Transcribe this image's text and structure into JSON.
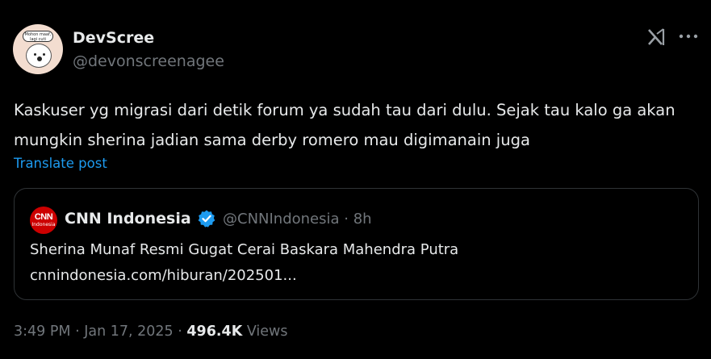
{
  "author": {
    "display_name": "DevScree",
    "handle": "@devonscreenagee",
    "avatar_caption": "Mohon maaf, lagi cuti",
    "avatar_icon": "cartoon-character-avatar"
  },
  "header_icons": {
    "grok": "grok-icon",
    "more": "more-options-icon"
  },
  "tweet": {
    "text": "Kaskuser yg migrasi dari detik forum ya sudah tau dari dulu. Sejak tau kalo ga akan mungkin sherina jadian sama derby romero mau digimanain juga",
    "translate_label": "Translate post"
  },
  "quote": {
    "logo_text": "CNN",
    "logo_subtext": "Indonesia",
    "name": "CNN Indonesia",
    "handle_time": "@CNNIndonesia · 8h",
    "title": "Sherina Munaf Resmi Gugat Cerai Baskara Mahendra Putra",
    "link": "cnnindonesia.com/hiburan/202501..."
  },
  "meta": {
    "time_date": "3:49 PM · Jan 17, 2025 · ",
    "views_count": "496.4K",
    "views_label": " Views"
  },
  "colors": {
    "accent": "#1d9bf0",
    "verified": "#1d9bf0",
    "cnn_red": "#cc0000",
    "muted": "#71767b"
  }
}
